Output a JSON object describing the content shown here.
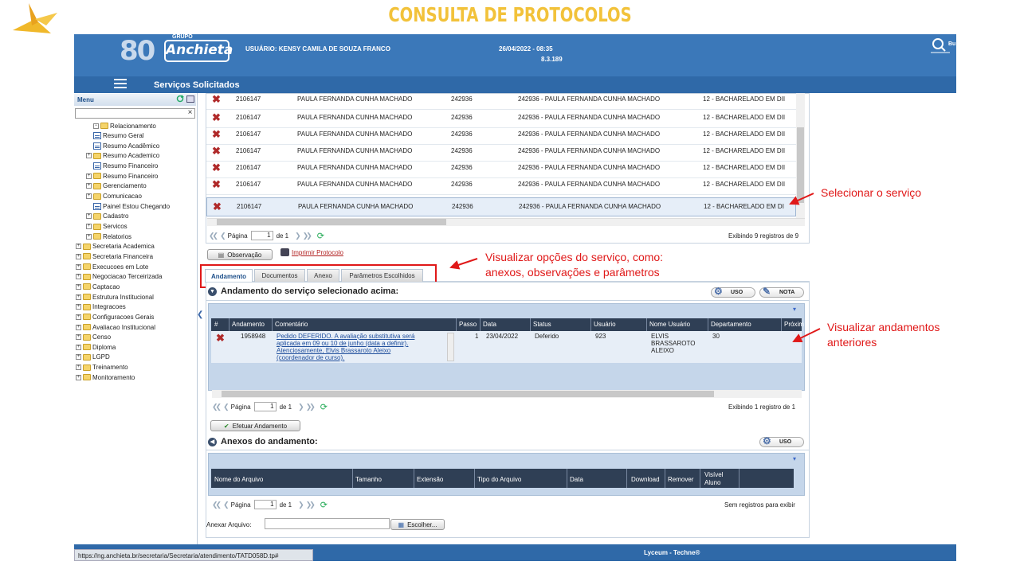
{
  "slide": {
    "title": "CONSULTA DE PROTOCOLOS"
  },
  "colors": {
    "header_blue": "#3b78b9",
    "accent_red": "#e01818",
    "title_gold": "#f2c23a",
    "grid_header": "#2f3f55"
  },
  "header": {
    "logo_number": "8",
    "logo_zero": "0",
    "logo_group": "GRUPO",
    "logo_brand": "Anchieta",
    "user": "USUÁRIO: KENSY CAMILA DE SOUZA FRANCO",
    "datetime": "26/04/2022 - 08:35",
    "version": "8.3.189",
    "search_label": "Bu",
    "section_title": "Serviços Solicitados"
  },
  "sidebar": {
    "menu_label": "Menu",
    "clear_glyph": "×",
    "items": [
      {
        "label": "Relacionamento",
        "type": "folder",
        "exp": "−"
      },
      {
        "label": "Resumo Geral",
        "type": "doc",
        "exp": ""
      },
      {
        "label": "Resumo Acadêmico",
        "type": "doc",
        "exp": ""
      },
      {
        "label": "Resumo Academico",
        "type": "folder",
        "exp": "+"
      },
      {
        "label": "Resumo Financeiro",
        "type": "doc",
        "exp": ""
      },
      {
        "label": "Resumo Financeiro",
        "type": "folder",
        "exp": "+"
      },
      {
        "label": "Gerenciamento",
        "type": "folder",
        "exp": "+"
      },
      {
        "label": "Comunicacao",
        "type": "folder",
        "exp": "+"
      },
      {
        "label": "Painel Estou Chegando",
        "type": "doc",
        "exp": ""
      },
      {
        "label": "Cadastro",
        "type": "folder",
        "exp": "+"
      },
      {
        "label": "Servicos",
        "type": "folder",
        "exp": "+"
      },
      {
        "label": "Relatorios",
        "type": "folder",
        "exp": "+"
      },
      {
        "label": "Secretaria Academica",
        "type": "folder",
        "exp": "+"
      },
      {
        "label": "Secretaria Financeira",
        "type": "folder",
        "exp": "+"
      },
      {
        "label": "Execucoes em Lote",
        "type": "folder",
        "exp": "+"
      },
      {
        "label": "Negociacao Terceirizada",
        "type": "folder",
        "exp": "+"
      },
      {
        "label": "Captacao",
        "type": "folder",
        "exp": "+"
      },
      {
        "label": "Estrutura Institucional",
        "type": "folder",
        "exp": "+"
      },
      {
        "label": "Integracoes",
        "type": "folder",
        "exp": "+"
      },
      {
        "label": "Configuracoes Gerais",
        "type": "folder",
        "exp": "+"
      },
      {
        "label": "Avaliacao Institucional",
        "type": "folder",
        "exp": "+"
      },
      {
        "label": "Censo",
        "type": "folder",
        "exp": "+"
      },
      {
        "label": "Diploma",
        "type": "folder",
        "exp": "+"
      },
      {
        "label": "LGPD",
        "type": "folder",
        "exp": "+"
      },
      {
        "label": "Treinamento",
        "type": "folder",
        "exp": "+"
      },
      {
        "label": "Monitoramento",
        "type": "folder",
        "exp": "+"
      }
    ]
  },
  "services_grid": {
    "rows": [
      {
        "id": "2106147",
        "name": "PAULA FERNANDA CUNHA MACHADO",
        "code": "242936",
        "desc": "242936 - PAULA FERNANDA CUNHA MACHADO",
        "course": "12 - BACHARELADO EM DII"
      },
      {
        "id": "2106147",
        "name": "PAULA FERNANDA CUNHA MACHADO",
        "code": "242936",
        "desc": "242936 - PAULA FERNANDA CUNHA MACHADO",
        "course": "12 - BACHARELADO EM DII"
      },
      {
        "id": "2106147",
        "name": "PAULA FERNANDA CUNHA MACHADO",
        "code": "242936",
        "desc": "242936 - PAULA FERNANDA CUNHA MACHADO",
        "course": "12 - BACHARELADO EM DII"
      },
      {
        "id": "2106147",
        "name": "PAULA FERNANDA CUNHA MACHADO",
        "code": "242936",
        "desc": "242936 - PAULA FERNANDA CUNHA MACHADO",
        "course": "12 - BACHARELADO EM DII"
      },
      {
        "id": "2106147",
        "name": "PAULA FERNANDA CUNHA MACHADO",
        "code": "242936",
        "desc": "242936 - PAULA FERNANDA CUNHA MACHADO",
        "course": "12 - BACHARELADO EM DII"
      },
      {
        "id": "2106147",
        "name": "PAULA FERNANDA CUNHA MACHADO",
        "code": "242936",
        "desc": "242936 - PAULA FERNANDA CUNHA MACHADO",
        "course": "12 - BACHARELADO EM DII"
      },
      {
        "id": "2106147",
        "name": "PAULA FERNANDA CUNHA MACHADO",
        "code": "242936",
        "desc": "242936 - PAULA FERNANDA CUNHA MACHADO",
        "course": "12 - BACHARELADO EM DI"
      }
    ],
    "pager": {
      "page_label": "Página",
      "page": "1",
      "of": "de 1",
      "info": "Exibindo 9 registros de 9"
    }
  },
  "actions": {
    "observacao": "Observação",
    "imprimir": "Imprimir Protocolo"
  },
  "tabs": [
    "Andamento",
    "Documentos",
    "Anexo",
    "Parâmetros Escolhidos"
  ],
  "andamento": {
    "title": "Andamento do serviço selecionado acima:",
    "uso": "USO",
    "nota": "NOTA",
    "columns": [
      "#",
      "Andamento",
      "Comentário",
      "Passo",
      "Data",
      "Status",
      "Usuário",
      "Nome Usuário",
      "Departamento",
      "Próxim"
    ],
    "row": {
      "andamento": "1958948",
      "comment_l1": "Pedido DEFERIDO. A avaliação substitutiva será",
      "comment_l2": "aplicada em 09 ou 10 de junho (data a definir).",
      "comment_l3": "Atenciosamente, Elvis Brassaroto Aleixo",
      "comment_l4": "(coordenador de curso).",
      "passo": "1",
      "data": "23/04/2022",
      "status": "Deferido",
      "usuario": "923",
      "nome_l1": "ELVIS",
      "nome_l2": "BRASSAROTO",
      "nome_l3": "ALEIXO",
      "departamento": "30"
    },
    "pager": {
      "page_label": "Página",
      "page": "1",
      "of": "de 1",
      "info": "Exibindo 1 registro de 1"
    },
    "efetuar": "Efetuar Andamento"
  },
  "anexos": {
    "title": "Anexos do andamento:",
    "uso": "USO",
    "columns": [
      "Nome do Arquivo",
      "Tamanho",
      "Extensão",
      "Tipo do Arquivo",
      "Data",
      "Download",
      "Remover",
      "Visível",
      "Aluno"
    ],
    "pager": {
      "page_label": "Página",
      "page": "1",
      "of": "de 1",
      "info": "Sem registros para exibir"
    },
    "anexar_label": "Anexar Arquivo:",
    "escolher": "Escolher..."
  },
  "annotations": {
    "selecionar": "Selecionar o serviço",
    "visualizar_l1": "Visualizar opções do serviço, como:",
    "visualizar_l2": "anexos, observações e parâmetros",
    "andamentos_l1": "Visualizar andamentos",
    "andamentos_l2": "anteriores"
  },
  "footer": {
    "url": "https://ng.anchieta.br/secretaria/Secretaria/atendimento/TATD058D.tp#",
    "brand": "Lyceum - Techne®"
  }
}
